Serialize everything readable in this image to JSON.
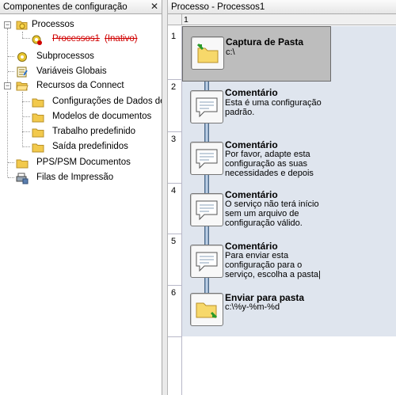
{
  "left_panel": {
    "title": "Componentes de configuração",
    "close_glyph": "✕",
    "tree": {
      "processos": "Processos",
      "processos1": "Processos1",
      "inativo": "(Inativo)",
      "subprocessos": "Subprocessos",
      "variaveis": "Variáveis Globais",
      "recursos": "Recursos da Connect",
      "config_dados": "Configurações de Dados de",
      "modelos": "Modelos de documentos",
      "trabalho": "Trabalho predefinido",
      "saida": "Saída predefinidos",
      "pps": "PPS/PSM Documentos",
      "filas": "Filas de Impressão"
    }
  },
  "right_panel": {
    "title": "Processo - Processos1",
    "column_number": "1",
    "rows": [
      "1",
      "2",
      "3",
      "4",
      "5",
      "6"
    ],
    "steps": [
      {
        "title": "Captura de Pasta",
        "desc": "c:\\"
      },
      {
        "title": "Comentário",
        "desc": "Esta é uma configuração\npadrão."
      },
      {
        "title": "Comentário",
        "desc": "Por favor, adapte esta\nconfiguração as suas\nnecessidades e depois"
      },
      {
        "title": "Comentário",
        "desc": "O serviço não terá início\nsem um arquivo de\nconfiguração válido."
      },
      {
        "title": "Comentário",
        "desc": "Para enviar esta\nconfiguração para o\nserviço, escolha a pasta|"
      },
      {
        "title": "Enviar para pasta",
        "desc": "c:\\%y-%m-%d"
      }
    ]
  },
  "colors": {
    "inactive_text": "#d00000",
    "grid_background": "#dfe5ee",
    "selected_step": "#bdbdbd",
    "connector": "#6f8fb3",
    "folder": "#f2c94c"
  }
}
